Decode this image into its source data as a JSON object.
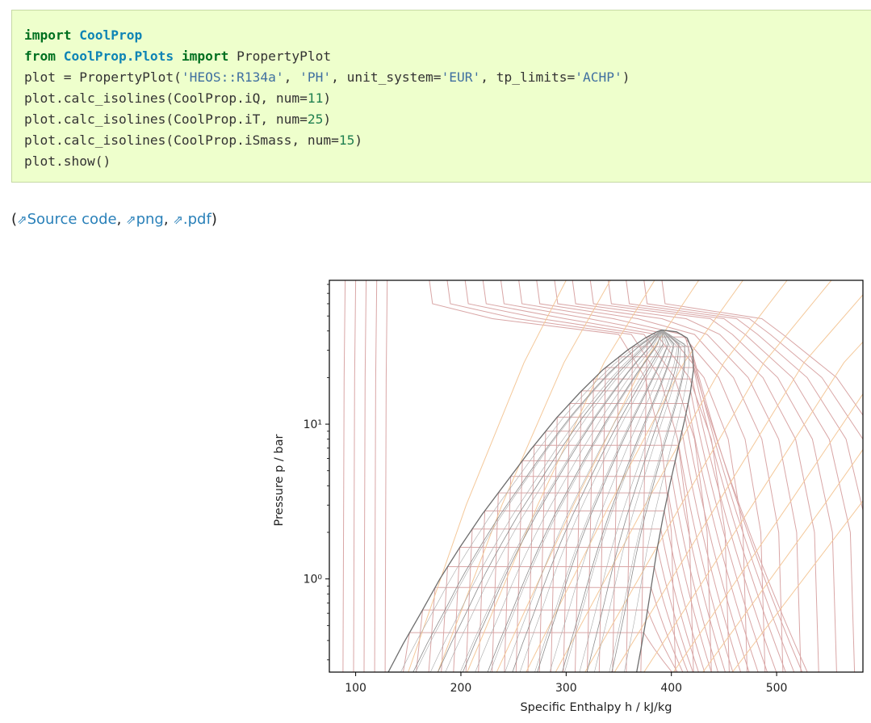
{
  "code": {
    "lines": [
      [
        {
          "t": "import",
          "c": "kw"
        },
        {
          "t": " "
        },
        {
          "t": "CoolProp",
          "c": "mod"
        }
      ],
      [
        {
          "t": "from",
          "c": "kw"
        },
        {
          "t": " "
        },
        {
          "t": "CoolProp.Plots",
          "c": "mod"
        },
        {
          "t": " "
        },
        {
          "t": "import",
          "c": "kw"
        },
        {
          "t": " PropertyPlot"
        }
      ],
      [
        {
          "t": "plot = PropertyPlot("
        },
        {
          "t": "'HEOS::R134a'",
          "c": "str"
        },
        {
          "t": ", "
        },
        {
          "t": "'PH'",
          "c": "str"
        },
        {
          "t": ", unit_system="
        },
        {
          "t": "'EUR'",
          "c": "str"
        },
        {
          "t": ", tp_limits="
        },
        {
          "t": "'ACHP'",
          "c": "str"
        },
        {
          "t": ")"
        }
      ],
      [
        {
          "t": "plot.calc_isolines(CoolProp.iQ, num="
        },
        {
          "t": "11",
          "c": "num"
        },
        {
          "t": ")"
        }
      ],
      [
        {
          "t": "plot.calc_isolines(CoolProp.iT, num="
        },
        {
          "t": "25",
          "c": "num"
        },
        {
          "t": ")"
        }
      ],
      [
        {
          "t": "plot.calc_isolines(CoolProp.iSmass, num="
        },
        {
          "t": "15",
          "c": "num"
        },
        {
          "t": ")"
        }
      ],
      [
        {
          "t": "plot.show()"
        }
      ]
    ]
  },
  "links": {
    "open": "(",
    "source": "Source code",
    "sep1": ", ",
    "png": "png",
    "sep2": ", ",
    "pdf": ".pdf",
    "close": ")",
    "icon": "↗-arrow-icon"
  },
  "chart_data": {
    "type": "line",
    "title": "",
    "xlabel": "Specific Enthalpy h / kJ/kg",
    "ylabel": "Pressure p / bar",
    "xlim": [
      75,
      582
    ],
    "ylim": [
      0.25,
      85
    ],
    "yscale": "log",
    "xticks": [
      100,
      200,
      300,
      400,
      500
    ],
    "yticks": [
      {
        "value": 1,
        "label": "10⁰"
      },
      {
        "value": 10,
        "label": "10¹"
      }
    ],
    "grid": false,
    "colors": {
      "saturation": "#6e6e6e",
      "quality": "#8c8c8c",
      "isotherm": "#d9a6a6",
      "isentrope": "#f4c89a"
    },
    "saturation_dome": {
      "liquid": [
        [
          131,
          0.25
        ],
        [
          145,
          0.38
        ],
        [
          163,
          0.62
        ],
        [
          180,
          1.0
        ],
        [
          199,
          1.6
        ],
        [
          220,
          2.6
        ],
        [
          243,
          4.2
        ],
        [
          266,
          6.8
        ],
        [
          291,
          11
        ],
        [
          313,
          16
        ],
        [
          335,
          22.5
        ],
        [
          358,
          30
        ],
        [
          375,
          36
        ],
        [
          386,
          39.5
        ],
        [
          391,
          40.6
        ]
      ],
      "vapor": [
        [
          367,
          0.25
        ],
        [
          371,
          0.35
        ],
        [
          376,
          0.55
        ],
        [
          381,
          0.9
        ],
        [
          386,
          1.5
        ],
        [
          392,
          2.5
        ],
        [
          399,
          4.2
        ],
        [
          406,
          6.8
        ],
        [
          413,
          11
        ],
        [
          418,
          16
        ],
        [
          421,
          22.5
        ],
        [
          420,
          30
        ],
        [
          415,
          36
        ],
        [
          405,
          39.5
        ],
        [
          391,
          40.6
        ]
      ]
    },
    "quality_lines": [
      0.1,
      0.2,
      0.3,
      0.4,
      0.5,
      0.6,
      0.7,
      0.8,
      0.9
    ],
    "isotherm_pressures": [
      0.45,
      0.63,
      0.88,
      1.2,
      1.6,
      2.1,
      2.75,
      3.6,
      4.6,
      5.8,
      7.3,
      9.0,
      11.1,
      13.6,
      16.4,
      19.6,
      23.2,
      27.2,
      31.7,
      36.6
    ],
    "isentrope_starts": [
      [
        155,
        0.25
      ],
      [
        200,
        0.25
      ],
      [
        248,
        0.25
      ],
      [
        296,
        0.25
      ],
      [
        348,
        0.25
      ]
    ]
  }
}
